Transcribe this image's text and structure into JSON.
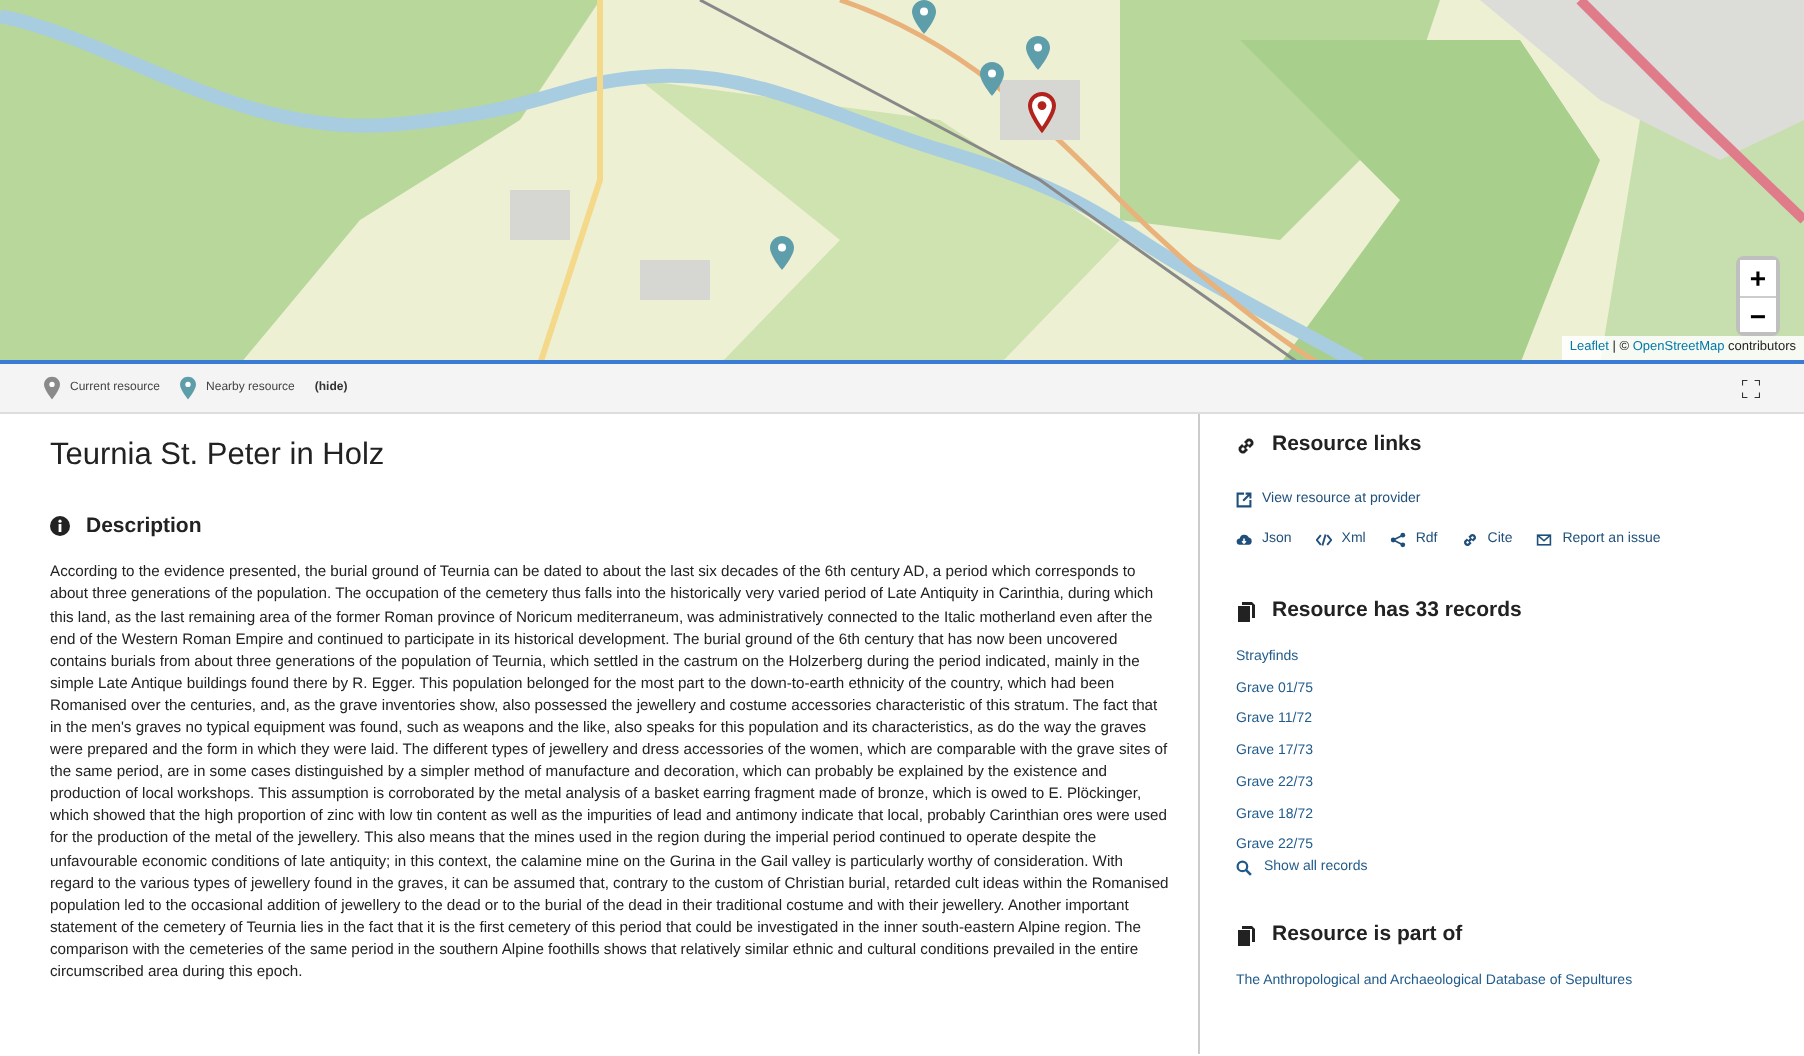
{
  "map": {
    "zoom_in": "+",
    "zoom_out": "−",
    "attribution": {
      "leaflet": "Leaflet",
      "separator": "| ©",
      "osm": "OpenStreetMap",
      "suffix": "contributors"
    }
  },
  "legend": {
    "items": [
      {
        "kind": "current",
        "label": "Current resource"
      },
      {
        "kind": "nearby",
        "label": "Nearby resource"
      }
    ],
    "hide": "(hide)"
  },
  "title": "Teurnia St. Peter in Holz",
  "description": {
    "heading": "Description",
    "text": "According to the evidence presented, the burial ground of Teurnia can be dated to about the last six decades of the 6th century AD, a period which corresponds to about three generations of the population. The occupation of the cemetery thus falls into the historically very varied period of Late Antiquity in Carinthia, during which this land, as the last remaining area of the former Roman province of Noricum mediterraneum, was administratively connected to the Italic motherland even after the end of the Western Roman Empire and continued to participate in its historical development. The burial ground of the 6th century that has now been uncovered contains burials from about three generations of the population of Teurnia, which settled in the castrum on the Holzerberg during the period indicated, mainly in the simple Late Antique buildings found there by R. Egger. This population belonged for the most part to the down-to-earth ethnicity of the country, which had been Romanised over the centuries, and, as the grave inventories show, also possessed the jewellery and costume accessories characteristic of this stratum. The fact that in the men's graves no typical equipment was found, such as weapons and the like, also speaks for this population and its characteristics, as do the way the graves were prepared and the form in which they were laid. The different types of jewellery and dress accessories of the women, which are comparable with the grave sites of the same period, are in some cases distinguished by a simpler method of manufacture and decoration, which can probably be explained by the existence and production of local workshops. This assumption is corroborated by the metal analysis of a basket earring fragment made of bronze, which is owed to E. Plöckinger, which showed that the high proportion of zinc with low tin content as well as the impurities of lead and antimony indicate that local, probably Carinthian ores were used for the production of the metal of the jewellery. This also means that the mines used in the region during the imperial period continued to operate despite the unfavourable economic conditions of late antiquity; in this context, the calamine mine on the Gurina in the Gail valley is particularly worthy of consideration. With regard to the various types of jewellery found in the graves, it can be assumed that, contrary to the custom of Christian burial, retarded cult ideas within the Romanised population led to the occasional addition of jewellery to the dead or to the burial of the dead in their traditional costume and with their jewellery. Another important statement of the cemetery of Teurnia lies in the fact that it is the first cemetery of this period that could be investigated in the inner south-eastern Alpine region. The comparison with the cemeteries of the same period in the southern Alpine foothills shows that relatively similar ethnic and cultural conditions prevailed in the entire circumscribed area during this epoch."
  },
  "resource_links": {
    "heading": "Resource links",
    "view": "View resource at provider",
    "formats": [
      {
        "kind": "json",
        "label": "Json"
      },
      {
        "kind": "xml",
        "label": "Xml"
      },
      {
        "kind": "rdf",
        "label": "Rdf"
      },
      {
        "kind": "cite",
        "label": "Cite"
      },
      {
        "kind": "report",
        "label": "Report an issue"
      }
    ]
  },
  "records": {
    "heading": "Resource has 33 records",
    "items": [
      "Strayfinds",
      "Grave 01/75",
      "Grave 11/72",
      "Grave 17/73",
      "Grave 22/73",
      "Grave 18/72",
      "Grave 22/75"
    ],
    "show_all": "Show all records"
  },
  "part_of": {
    "heading": "Resource is part of",
    "items": [
      "The Anthropological and Archaeological Database of Sepultures"
    ]
  }
}
